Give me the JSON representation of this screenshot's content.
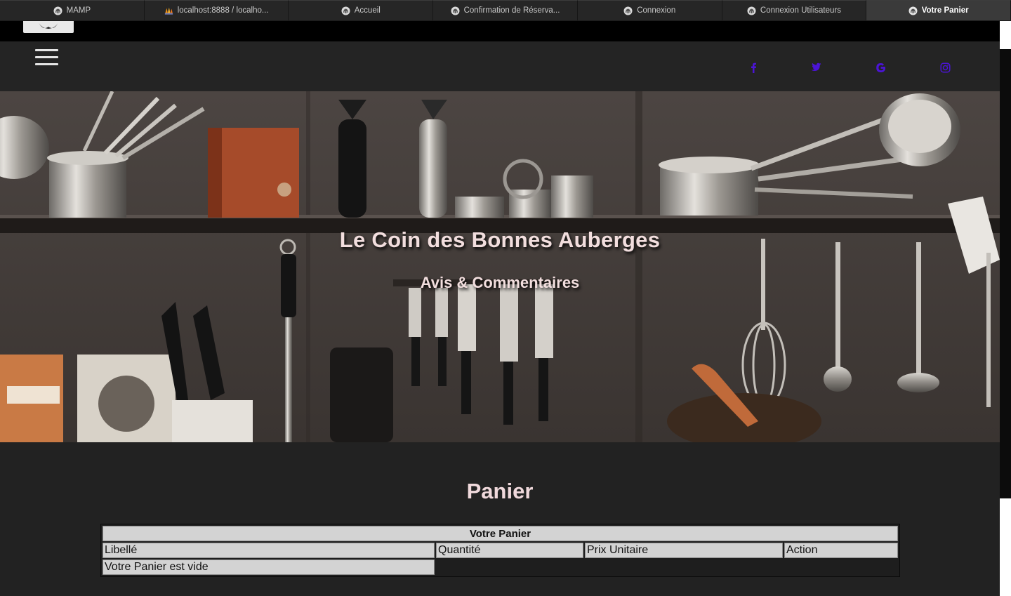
{
  "browser": {
    "tabs": [
      {
        "label": "MAMP",
        "icon": "mamp-elephant-icon",
        "active": false
      },
      {
        "label": "localhost:8888 / localho...",
        "icon": "phpmyadmin-icon",
        "active": false
      },
      {
        "label": "Accueil",
        "icon": "mamp-elephant-icon",
        "active": false
      },
      {
        "label": "Confirmation de Réserva...",
        "icon": "mamp-elephant-icon",
        "active": false
      },
      {
        "label": "Connexion",
        "icon": "mamp-elephant-icon",
        "active": false
      },
      {
        "label": "Connexion Utilisateurs",
        "icon": "mamp-elephant-icon",
        "active": false
      },
      {
        "label": "Votre Panier",
        "icon": "mamp-elephant-icon",
        "active": true
      }
    ]
  },
  "navbar": {
    "menu_icon": "hamburger-menu-icon",
    "social": [
      {
        "name": "facebook",
        "icon": "facebook-icon"
      },
      {
        "name": "twitter",
        "icon": "twitter-icon"
      },
      {
        "name": "google",
        "icon": "google-icon"
      },
      {
        "name": "instagram",
        "icon": "instagram-icon"
      }
    ],
    "social_color": "#4b14d6"
  },
  "hero": {
    "title": "Le Coin des Bonnes Auberges",
    "subtitle": "Avis & Commentaires",
    "text_color": "#f2dede"
  },
  "panier": {
    "heading": "Panier",
    "table": {
      "caption": "Votre Panier",
      "headers": [
        "Libellé",
        "Quantité",
        "Prix Unitaire",
        "Action"
      ],
      "empty_message": "Votre Panier est vide"
    }
  }
}
